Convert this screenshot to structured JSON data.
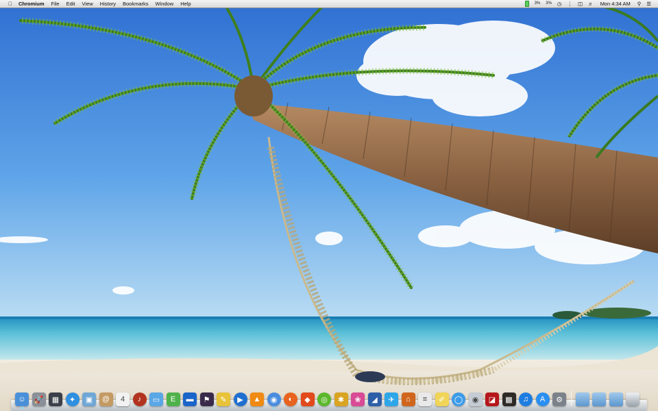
{
  "menubar": {
    "apple_icon": "apple-logo-icon",
    "app_name": "Chromium",
    "menus": [
      "File",
      "Edit",
      "View",
      "History",
      "Bookmarks",
      "Window",
      "Help"
    ],
    "status": {
      "battery_icon": "battery-icon",
      "cpu_1": "3%",
      "cpu_2": "3%",
      "wifi_icon": "wifi-icon",
      "volume_icon": "volume-icon",
      "clock": "Mon 4:34 AM",
      "spotlight_icon": "spotlight-search-icon",
      "notification_icon": "notification-center-icon"
    }
  },
  "wallpaper": {
    "description_icon": "beach-hammock-wallpaper"
  },
  "dock": {
    "apps": [
      {
        "name": "finder-icon",
        "glyph": "☺",
        "color": "#4a90d9",
        "running": true
      },
      {
        "name": "launchpad-icon",
        "glyph": "🚀",
        "color": "#8a8f98",
        "running": false
      },
      {
        "name": "mission-control-icon",
        "glyph": "▦",
        "color": "#3a3f49",
        "running": false
      },
      {
        "name": "safari-icon",
        "glyph": "✦",
        "color": "#2f8fe0",
        "running": false
      },
      {
        "name": "preview-icon",
        "glyph": "▣",
        "color": "#6fa7d6",
        "running": false
      },
      {
        "name": "contacts-icon",
        "glyph": "@",
        "color": "#c49a63",
        "running": false
      },
      {
        "name": "calendar-icon",
        "glyph": "4",
        "color": "#f2f2f2",
        "running": false
      },
      {
        "name": "itunes-photo-icon",
        "glyph": "♪",
        "color": "#b2331f",
        "running": false
      },
      {
        "name": "disk-utility-icon",
        "glyph": "▭",
        "color": "#5aa7e6",
        "running": false
      },
      {
        "name": "evernote-icon",
        "glyph": "E",
        "color": "#4fb24a",
        "running": false
      },
      {
        "name": "terminal-icon",
        "glyph": "▬",
        "color": "#1b64c9",
        "running": false
      },
      {
        "name": "alfred-icon",
        "glyph": "⚑",
        "color": "#3a2a4a",
        "running": false
      },
      {
        "name": "stickies-icon",
        "glyph": "✎",
        "color": "#e8c33a",
        "running": false
      },
      {
        "name": "quicktime-icon",
        "glyph": "▶",
        "color": "#1f6fd0",
        "running": false
      },
      {
        "name": "vlc-icon",
        "glyph": "▲",
        "color": "#f08a12",
        "running": false
      },
      {
        "name": "chromium-icon",
        "glyph": "◉",
        "color": "#4a8de0",
        "running": true
      },
      {
        "name": "firefox-icon",
        "glyph": "◐",
        "color": "#e8631f",
        "running": false
      },
      {
        "name": "office-icon",
        "glyph": "◆",
        "color": "#e24a1c",
        "running": false
      },
      {
        "name": "music-player-icon",
        "glyph": "◎",
        "color": "#5ab82a",
        "running": false
      },
      {
        "name": "system-tool-icon",
        "glyph": "✱",
        "color": "#d9a421",
        "running": false
      },
      {
        "name": "photo-booth-icon",
        "glyph": "❀",
        "color": "#d84a95",
        "running": false
      },
      {
        "name": "cyberduck-icon",
        "glyph": "◢",
        "color": "#2c5fa8",
        "running": false
      },
      {
        "name": "twitter-icon",
        "glyph": "✈",
        "color": "#2ea6e8",
        "running": false
      },
      {
        "name": "home-icon",
        "glyph": "⌂",
        "color": "#d0661d",
        "running": false
      },
      {
        "name": "textedit-icon",
        "glyph": "≡",
        "color": "#e9e9e9",
        "running": false
      },
      {
        "name": "notes-icon",
        "glyph": "✐",
        "color": "#f0d558",
        "running": false
      },
      {
        "name": "messages-icon",
        "glyph": "◯",
        "color": "#3d9be9",
        "running": false
      },
      {
        "name": "webcam-icon",
        "glyph": "◉",
        "color": "#c6ccd4",
        "running": false
      },
      {
        "name": "flashcards-icon",
        "glyph": "◪",
        "color": "#b5171b",
        "running": false
      },
      {
        "name": "photos-icon",
        "glyph": "▩",
        "color": "#2e2a26",
        "running": false
      },
      {
        "name": "itunes-icon",
        "glyph": "♫",
        "color": "#1e7de0",
        "running": false
      },
      {
        "name": "app-store-icon",
        "glyph": "A",
        "color": "#2a8ff0",
        "running": false
      },
      {
        "name": "system-preferences-icon",
        "glyph": "⚙",
        "color": "#7b828a",
        "running": false
      }
    ],
    "stacks": [
      {
        "name": "applications-folder-icon"
      },
      {
        "name": "documents-folder-icon"
      },
      {
        "name": "downloads-folder-icon"
      }
    ],
    "trash": {
      "name": "trash-icon"
    }
  }
}
